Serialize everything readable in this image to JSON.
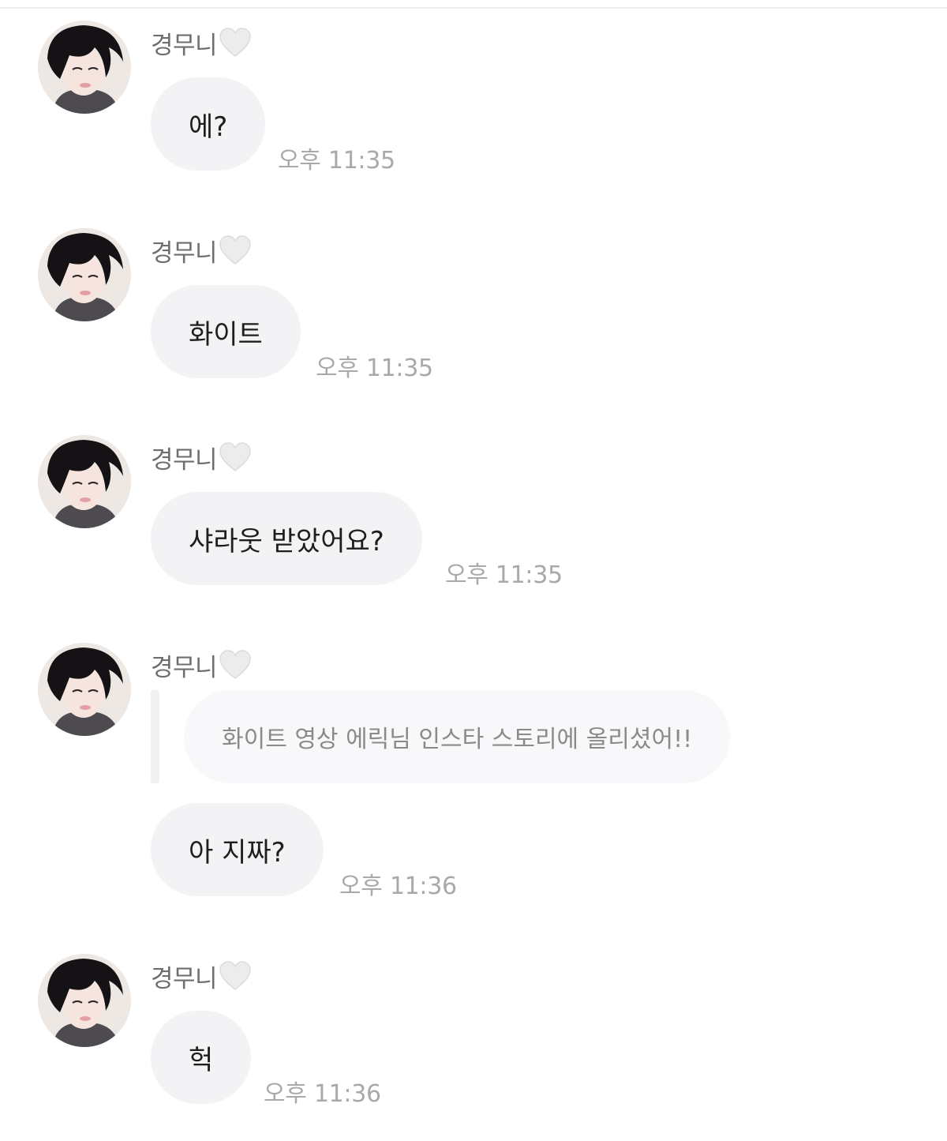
{
  "messages": [
    {
      "sender": "경무니",
      "text": "에?",
      "time": "오후 11:35"
    },
    {
      "sender": "경무니",
      "text": "화이트",
      "time": "오후 11:35"
    },
    {
      "sender": "경무니",
      "text": "샤라웃 받았어요?",
      "time": "오후 11:35"
    },
    {
      "sender": "경무니",
      "reply_to": "화이트 영상 에릭님 인스타 스토리에 올리셨어!!",
      "text": "아 지짜?",
      "time": "오후 11:36"
    },
    {
      "sender": "경무니",
      "text": "헉",
      "time": "오후 11:36"
    }
  ],
  "colors": {
    "bubble": "#f3f3f5",
    "time_text": "#a9a9a9",
    "sender_text": "#6e6e6e",
    "heart": "#e9e9e9"
  },
  "icons": {
    "avatar": "profile-photo-avatar",
    "heart": "white-heart-icon"
  }
}
